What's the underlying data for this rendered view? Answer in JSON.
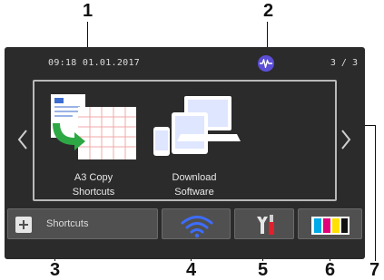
{
  "callouts": [
    "1",
    "2",
    "3",
    "4",
    "5",
    "6",
    "7"
  ],
  "status_bar": {
    "datetime": "09:18 01.01.2017",
    "page_indicator": "3 / 3",
    "wireless_status_icon": "wireless-waveform-icon"
  },
  "tiles": [
    {
      "label_line1": "A3 Copy",
      "label_line2": "Shortcuts",
      "icon": "a3-copy-icon"
    },
    {
      "label_line1": "Download",
      "label_line2": "Software",
      "icon": "devices-icon"
    }
  ],
  "bottom_bar": {
    "shortcuts_label": "Shortcuts",
    "wifi_icon": "wifi-icon",
    "settings_icon": "tools-icon",
    "toner_icon": "toner-icon"
  },
  "colors": {
    "screen_bg": "#2b2b2b",
    "button_bg": "#505050",
    "wifi_blue": "#3d6dff",
    "badge_purple": "#5c4fd6",
    "toner_cyan": "#00a9e8",
    "toner_magenta": "#e2007a",
    "toner_yellow": "#ffe100",
    "toner_black": "#111111"
  }
}
